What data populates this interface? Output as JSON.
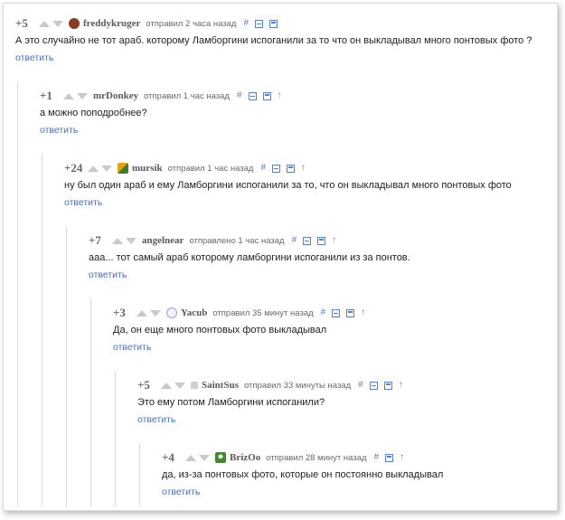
{
  "actions": {
    "link": "#",
    "up": "↑"
  },
  "comments": [
    {
      "rating": "+5",
      "user": "freddykruger",
      "time": "отправил 2 часа назад",
      "text": "А это случайно не тот араб. которому Ламборгини испоганили за то что он выкладывал много понтовых фото ?",
      "reply": "ответить"
    },
    {
      "rating": "+1",
      "user": "mrDonkey",
      "time": "отправил 1 час назад",
      "text": "а можно поподробнее?",
      "reply": "ответить"
    },
    {
      "rating": "+24",
      "user": "mursik",
      "time": "отправил 1 час назад",
      "text": "ну был один араб и ему Ламборгини испоганили за то, что он выкладывал много понтовых фото",
      "reply": "ответить"
    },
    {
      "rating": "+7",
      "user": "angelnear",
      "time": "отправлено 1 час назад",
      "text": "ааа... тот самый араб которому ламборгини испоганили из за понтов.",
      "reply": "ответить"
    },
    {
      "rating": "+3",
      "user": "Yacub",
      "time": "отправил 35 минут назад",
      "text": "Да, он еще много понтовых фото выкладывал",
      "reply": "ответить"
    },
    {
      "rating": "+5",
      "user": "SaintSus",
      "time": "отправил 33 минуты назад",
      "text": "Это ему потом Ламборгини испоганили?",
      "reply": "ответить"
    },
    {
      "rating": "+4",
      "user": "BrizOo",
      "time": "отправил 28 минут назад",
      "text": "да, из-за понтовых фото, которые он постоянно выкладывал",
      "reply": "ответить"
    }
  ]
}
